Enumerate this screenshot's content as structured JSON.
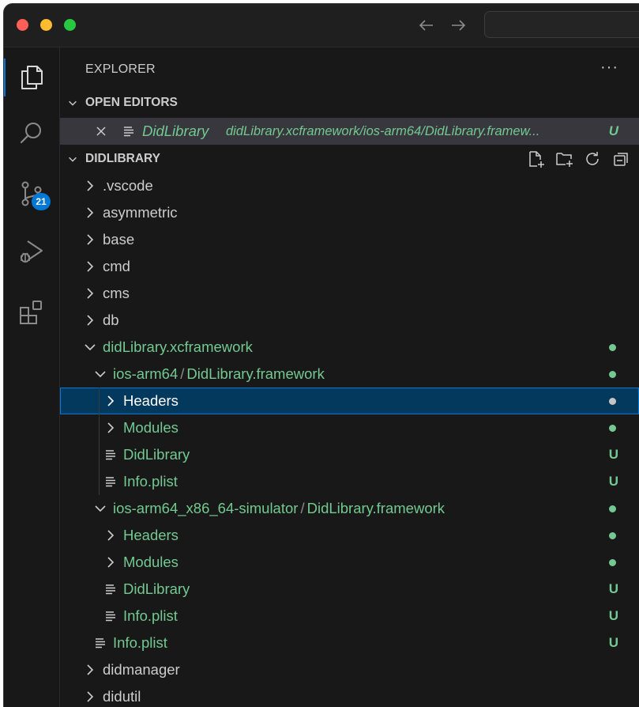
{
  "explorer": {
    "title": "EXPLORER",
    "more": "···"
  },
  "activity": {
    "scm_badge": "21"
  },
  "open_editors": {
    "header": "OPEN EDITORS",
    "items": [
      {
        "name": "DidLibrary",
        "path": "didLibrary.xcframework/ios-arm64/DidLibrary.framew...",
        "status": "U"
      }
    ]
  },
  "workspace": {
    "header": "DIDLIBRARY",
    "rows": [
      {
        "label": ".vscode"
      },
      {
        "label": "asymmetric"
      },
      {
        "label": "base"
      },
      {
        "label": "cmd"
      },
      {
        "label": "cms"
      },
      {
        "label": "db"
      },
      {
        "label": "didLibrary.xcframework"
      },
      {
        "label_a": "ios-arm64",
        "sep": "/",
        "label_b": "DidLibrary.framework"
      },
      {
        "label": "Headers"
      },
      {
        "label": "Modules"
      },
      {
        "label": "DidLibrary",
        "status": "U"
      },
      {
        "label": "Info.plist",
        "status": "U"
      },
      {
        "label_a": "ios-arm64_x86_64-simulator",
        "sep": "/",
        "label_b": "DidLibrary.framework"
      },
      {
        "label": "Headers"
      },
      {
        "label": "Modules"
      },
      {
        "label": "DidLibrary",
        "status": "U"
      },
      {
        "label": "Info.plist",
        "status": "U"
      },
      {
        "label": "Info.plist",
        "status": "U"
      },
      {
        "label": "didmanager"
      },
      {
        "label": "didutil"
      }
    ]
  },
  "colors": {
    "untracked": "#73c991",
    "selection": "#04395e",
    "focus_border": "#0078d4",
    "accent": "#0078d4"
  }
}
